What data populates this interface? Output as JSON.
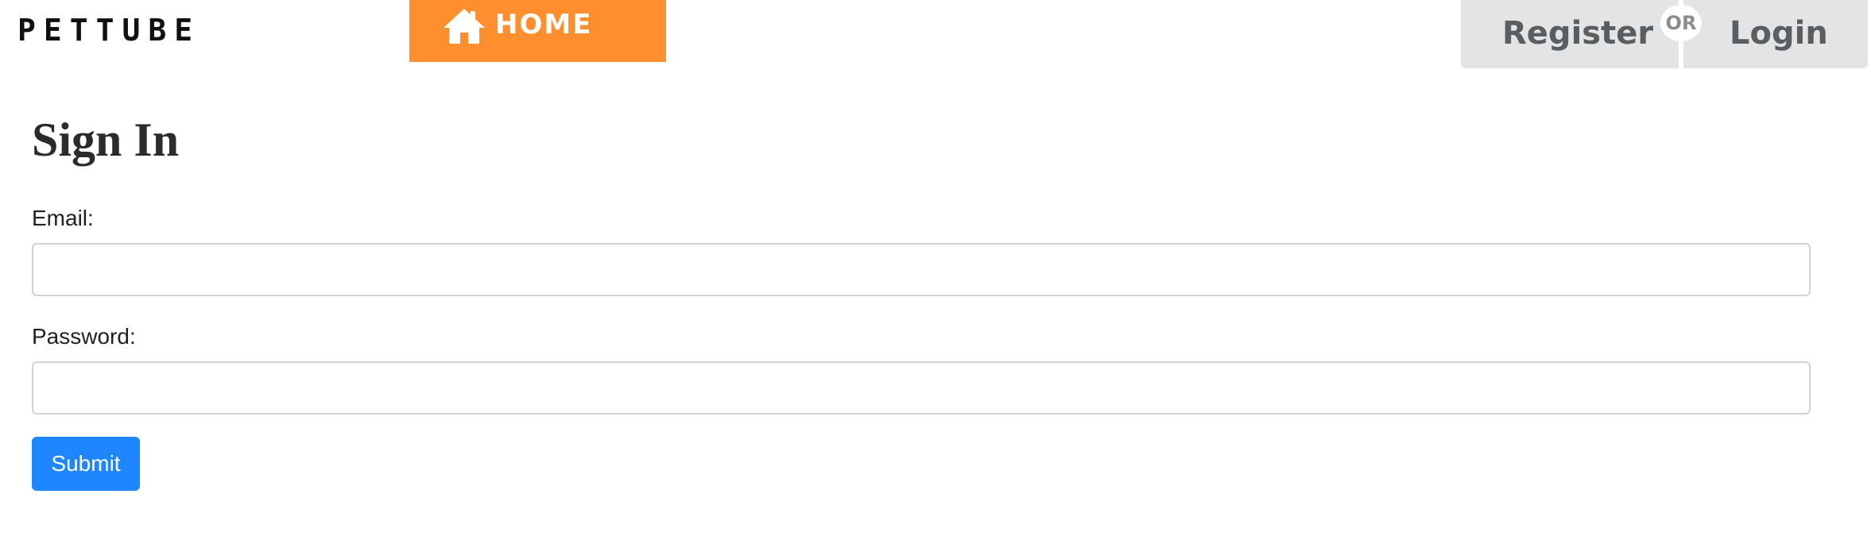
{
  "header": {
    "logo_text": "PETTUBE",
    "nav": {
      "home_label": "HOME",
      "home_icon": "home-icon",
      "accent_color": "#ff8f2e"
    },
    "auth": {
      "register_label": "Register",
      "separator_label": "OR",
      "login_label": "Login",
      "background_color": "#e3e4e5"
    }
  },
  "main": {
    "title": "Sign In",
    "form": {
      "email_label": "Email:",
      "email_value": "",
      "password_label": "Password:",
      "password_value": "",
      "submit_label": "Submit",
      "submit_color": "#1e86ff"
    }
  }
}
